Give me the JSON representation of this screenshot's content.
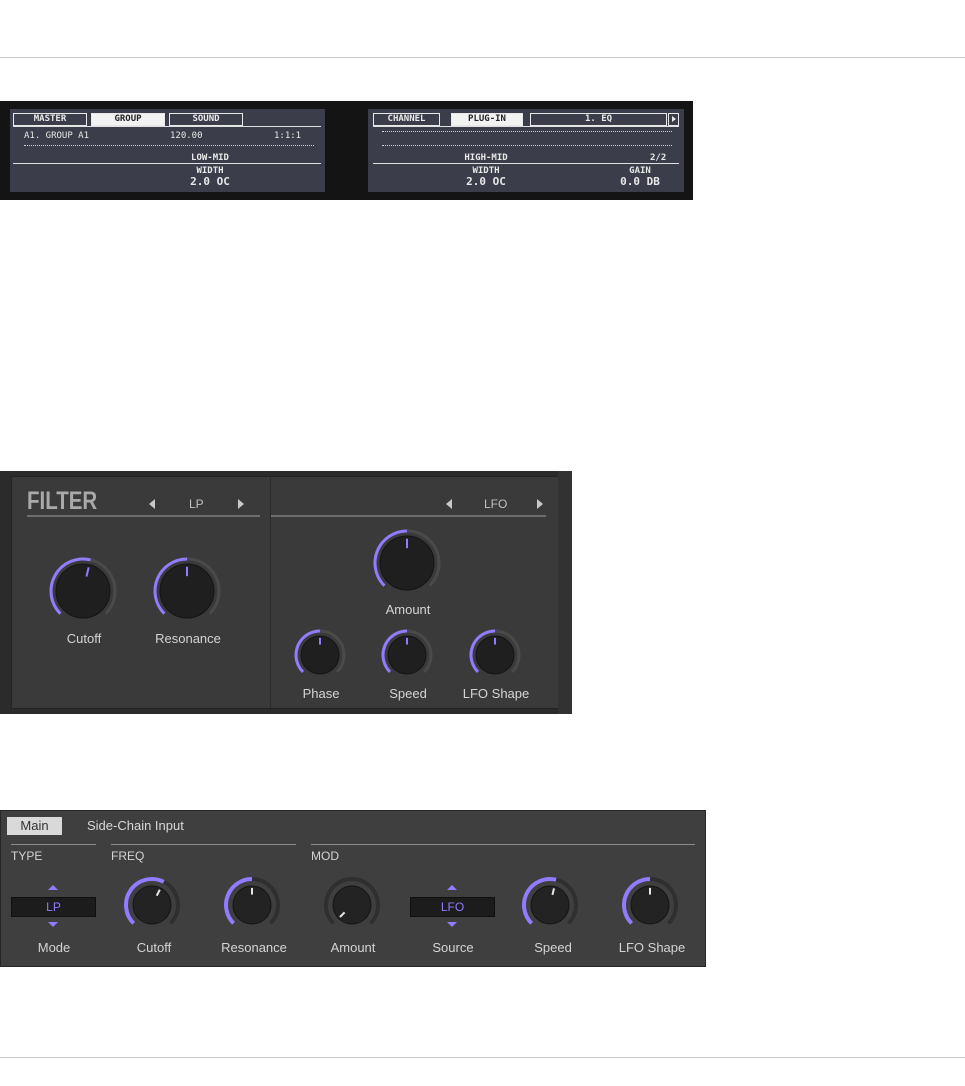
{
  "hardware_display": {
    "left_screen": {
      "tabs": [
        "MASTER",
        "GROUP",
        "SOUND"
      ],
      "active_tab": "GROUP",
      "group_name": "A1. GROUP A1",
      "tempo": "120.00",
      "position": "1:1:1",
      "section": "LOW-MID",
      "param_name": "WIDTH",
      "param_value": "2.0 OC"
    },
    "right_screen": {
      "tabs": [
        "CHANNEL",
        "PLUG-IN"
      ],
      "active_tab": "PLUG-IN",
      "plugin_name": "1. EQ",
      "section": "HIGH-MID",
      "page": "2/2",
      "params": [
        {
          "name": "WIDTH",
          "value": "2.0 OC"
        },
        {
          "name": "GAIN",
          "value": "0.0 DB"
        }
      ]
    }
  },
  "maschine_panel": {
    "title": "FILTER",
    "filter_type": "LP",
    "mod_source": "LFO",
    "knobs": {
      "cutoff": "Cutoff",
      "resonance": "Resonance",
      "amount": "Amount",
      "phase": "Phase",
      "speed": "Speed",
      "lfo_shape": "LFO Shape"
    }
  },
  "software_panel": {
    "tabs": {
      "main": "Main",
      "sidechain": "Side-Chain Input"
    },
    "sections": {
      "type": "TYPE",
      "freq": "FREQ",
      "mod": "MOD"
    },
    "mode_value": "LP",
    "source_value": "LFO",
    "labels": {
      "mode": "Mode",
      "cutoff": "Cutoff",
      "resonance": "Resonance",
      "amount": "Amount",
      "source": "Source",
      "speed": "Speed",
      "lfo_shape": "LFO Shape"
    }
  },
  "colors": {
    "accent": "#8f7cff",
    "screen_bg": "#3b3e4a",
    "panel_bg": "#3a3a3a"
  }
}
